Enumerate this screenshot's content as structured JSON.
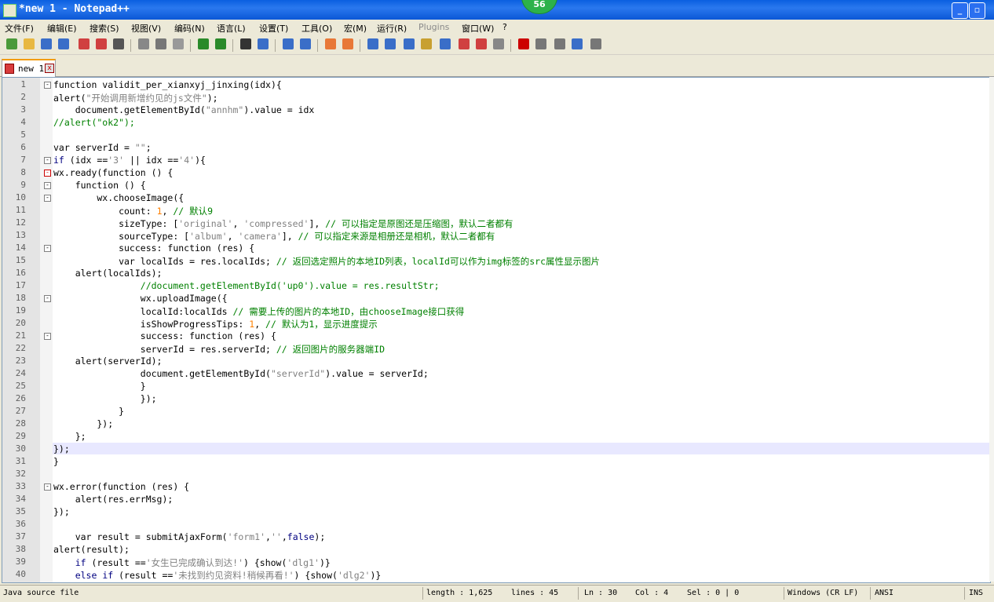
{
  "window": {
    "title": "*new 1 - Notepad++",
    "badge": "56",
    "controls": {
      "minimize": "_",
      "maximize": "▫"
    }
  },
  "menu": [
    "文件(F)",
    "编辑(E)",
    "搜索(S)",
    "视图(V)",
    "编码(N)",
    "语言(L)",
    "设置(T)",
    "工具(O)",
    "宏(M)",
    "运行(R)",
    "Plugins",
    "窗口(W)",
    "?"
  ],
  "toolbar": {
    "icons": [
      "new-file",
      "open-file",
      "save",
      "save-all",
      "close",
      "close-all",
      "print",
      "cut",
      "copy",
      "paste",
      "undo",
      "redo",
      "find",
      "replace",
      "zoom-in",
      "zoom-out",
      "sync-vertical",
      "sync-horizontal",
      "word-wrap",
      "show-all-chars",
      "indent-guide",
      "udl",
      "doc-map",
      "function-list",
      "folder-workspace",
      "monitor",
      "record-macro",
      "stop-record",
      "play-macro",
      "run-macro-multiple",
      "save-macro"
    ]
  },
  "tab": {
    "label": "new 1",
    "close": "x"
  },
  "editor": {
    "current_line": 30,
    "lines": [
      {
        "n": "1",
        "fold": "minus",
        "segs": [
          [
            "",
            "function validit_per_xianxyj_jinxing(idx){"
          ]
        ]
      },
      {
        "n": "2",
        "segs": [
          [
            "",
            "alert("
          ],
          [
            "s",
            "\"开始调用新增约见的js文件\""
          ],
          [
            "",
            ");"
          ]
        ]
      },
      {
        "n": "3",
        "segs": [
          [
            "",
            "    document.getElementById("
          ],
          [
            "s",
            "\"annhm\""
          ],
          [
            "",
            ").value = idx"
          ]
        ]
      },
      {
        "n": "4",
        "segs": [
          [
            "c",
            "//alert(\"ok2\");"
          ]
        ]
      },
      {
        "n": "5",
        "segs": []
      },
      {
        "n": "6",
        "segs": [
          [
            "",
            "var serverId = "
          ],
          [
            "s",
            "\"\""
          ],
          [
            "",
            ";"
          ]
        ]
      },
      {
        "n": "7",
        "fold": "minus",
        "segs": [
          [
            "k",
            "if"
          ],
          [
            "",
            " (idx =="
          ],
          [
            "s",
            "'3'"
          ],
          [
            "",
            " || idx =="
          ],
          [
            "s",
            "'4'"
          ],
          [
            "",
            "){"
          ]
        ]
      },
      {
        "n": "8",
        "fold": "minus-red",
        "segs": [
          [
            "",
            "wx.ready(function () {"
          ]
        ]
      },
      {
        "n": "9",
        "fold": "minus",
        "segs": [
          [
            "",
            "    function () {"
          ]
        ]
      },
      {
        "n": "10",
        "fold": "minus",
        "segs": [
          [
            "",
            "        wx.chooseImage({"
          ]
        ]
      },
      {
        "n": "11",
        "segs": [
          [
            "",
            "            count: "
          ],
          [
            "n",
            "1"
          ],
          [
            "",
            ", "
          ],
          [
            "c",
            "// 默认9"
          ]
        ]
      },
      {
        "n": "12",
        "segs": [
          [
            "",
            "            sizeType: ["
          ],
          [
            "s",
            "'original'"
          ],
          [
            "",
            ", "
          ],
          [
            "s",
            "'compressed'"
          ],
          [
            "",
            "], "
          ],
          [
            "c",
            "// 可以指定是原图还是压缩图，默认二者都有"
          ]
        ]
      },
      {
        "n": "13",
        "segs": [
          [
            "",
            "            sourceType: ["
          ],
          [
            "s",
            "'album'"
          ],
          [
            "",
            ", "
          ],
          [
            "s",
            "'camera'"
          ],
          [
            "",
            "], "
          ],
          [
            "c",
            "// 可以指定来源是相册还是相机，默认二者都有"
          ]
        ]
      },
      {
        "n": "14",
        "fold": "minus",
        "segs": [
          [
            "",
            "            success: function (res) {"
          ]
        ]
      },
      {
        "n": "15",
        "segs": [
          [
            "",
            "            var localIds = res.localIds; "
          ],
          [
            "c",
            "// 返回选定照片的本地ID列表，localId可以作为img标签的src属性显示图片"
          ]
        ]
      },
      {
        "n": "16",
        "segs": [
          [
            "",
            "    alert(localIds);"
          ]
        ]
      },
      {
        "n": "17",
        "segs": [
          [
            "c",
            "                //document.getElementById('up0').value = res.resultStr;"
          ]
        ]
      },
      {
        "n": "18",
        "fold": "minus",
        "segs": [
          [
            "",
            "                wx.uploadImage({"
          ]
        ]
      },
      {
        "n": "19",
        "segs": [
          [
            "",
            "                localId:localIds "
          ],
          [
            "c",
            "// 需要上传的图片的本地ID，由chooseImage接口获得"
          ]
        ]
      },
      {
        "n": "20",
        "segs": [
          [
            "",
            "                isShowProgressTips: "
          ],
          [
            "n",
            "1"
          ],
          [
            "",
            ", "
          ],
          [
            "c",
            "// 默认为1，显示进度提示"
          ]
        ]
      },
      {
        "n": "21",
        "fold": "minus",
        "segs": [
          [
            "",
            "                success: function (res) {"
          ]
        ]
      },
      {
        "n": "22",
        "segs": [
          [
            "",
            "                serverId = res.serverId; "
          ],
          [
            "c",
            "// 返回图片的服务器端ID"
          ]
        ]
      },
      {
        "n": "23",
        "segs": [
          [
            "",
            "    alert(serverId);"
          ]
        ]
      },
      {
        "n": "24",
        "segs": [
          [
            "",
            "                document.getElementById("
          ],
          [
            "s",
            "\"serverId\""
          ],
          [
            "",
            ").value = serverId;"
          ]
        ]
      },
      {
        "n": "25",
        "segs": [
          [
            "",
            "                }"
          ]
        ]
      },
      {
        "n": "26",
        "segs": [
          [
            "",
            "                });"
          ]
        ]
      },
      {
        "n": "27",
        "segs": [
          [
            "",
            "            }"
          ]
        ]
      },
      {
        "n": "28",
        "segs": [
          [
            "",
            "        });"
          ]
        ]
      },
      {
        "n": "29",
        "segs": [
          [
            "",
            "    };"
          ]
        ]
      },
      {
        "n": "30",
        "segs": [
          [
            "",
            "});"
          ]
        ]
      },
      {
        "n": "31",
        "segs": [
          [
            "",
            "}"
          ]
        ]
      },
      {
        "n": "32",
        "segs": []
      },
      {
        "n": "33",
        "fold": "minus",
        "segs": [
          [
            "",
            "wx.error(function (res) {"
          ]
        ]
      },
      {
        "n": "34",
        "segs": [
          [
            "",
            "    alert(res.errMsg);"
          ]
        ]
      },
      {
        "n": "35",
        "segs": [
          [
            "",
            "});"
          ]
        ]
      },
      {
        "n": "36",
        "segs": []
      },
      {
        "n": "37",
        "segs": [
          [
            "",
            "    var result = submitAjaxForm("
          ],
          [
            "s",
            "'form1'"
          ],
          [
            "",
            ","
          ],
          [
            "s",
            "''"
          ],
          [
            "",
            ","
          ],
          [
            "k",
            "false"
          ],
          [
            "",
            ");"
          ]
        ]
      },
      {
        "n": "38",
        "segs": [
          [
            "",
            "alert(result);"
          ]
        ]
      },
      {
        "n": "39",
        "segs": [
          [
            "",
            "    "
          ],
          [
            "k",
            "if"
          ],
          [
            "",
            " (result =="
          ],
          [
            "s",
            "'女生已完成确认到达!'"
          ],
          [
            "",
            ") {show("
          ],
          [
            "s",
            "'dlg1'"
          ],
          [
            "",
            ")}"
          ]
        ]
      },
      {
        "n": "40",
        "segs": [
          [
            "",
            "    "
          ],
          [
            "k",
            "else if"
          ],
          [
            "",
            " (result =="
          ],
          [
            "s",
            "'未找到约见资料!稍候再看!'"
          ],
          [
            "",
            ") {show("
          ],
          [
            "s",
            "'dlg2'"
          ],
          [
            "",
            ")}"
          ]
        ]
      }
    ]
  },
  "status": {
    "file_type": "Java source file",
    "length": "length : 1,625",
    "lines": "lines : 45",
    "ln": "Ln : 30",
    "col": "Col : 4",
    "sel": "Sel : 0 | 0",
    "eol": "Windows (CR LF)",
    "encoding": "ANSI",
    "mode": "INS"
  }
}
